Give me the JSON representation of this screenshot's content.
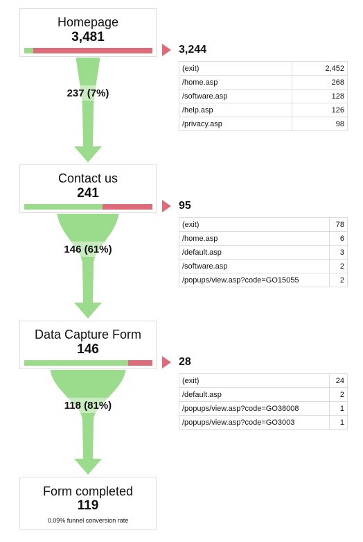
{
  "colors": {
    "continue": "#9bdc8c",
    "exit": "#dd6b7a"
  },
  "steps": [
    {
      "title": "Homepage",
      "count": "3,481",
      "continue_fraction": 0.07,
      "flow_label": "237 (7%)",
      "exit_count": "3,244",
      "exits": [
        {
          "page": "(exit)",
          "count": "2,452"
        },
        {
          "page": "/home.asp",
          "count": "268"
        },
        {
          "page": "/software.asp",
          "count": "128"
        },
        {
          "page": "/help.asp",
          "count": "126"
        },
        {
          "page": "/privacy.asp",
          "count": "98"
        }
      ]
    },
    {
      "title": "Contact us",
      "count": "241",
      "continue_fraction": 0.61,
      "flow_label": "146 (61%)",
      "exit_count": "95",
      "exits": [
        {
          "page": "(exit)",
          "count": "78"
        },
        {
          "page": "/home.asp",
          "count": "6"
        },
        {
          "page": "/default.asp",
          "count": "3"
        },
        {
          "page": "/software.asp",
          "count": "2"
        },
        {
          "page": "/popups/view.asp?code=GO15055",
          "count": "2"
        }
      ]
    },
    {
      "title": "Data Capture Form",
      "count": "146",
      "continue_fraction": 0.81,
      "flow_label": "118 (81%)",
      "exit_count": "28",
      "exits": [
        {
          "page": "(exit)",
          "count": "24"
        },
        {
          "page": "/default.asp",
          "count": "2"
        },
        {
          "page": "/popups/view.asp?code=GO38008",
          "count": "1"
        },
        {
          "page": "/popups/view.asp?code=GO3003",
          "count": "1"
        }
      ]
    }
  ],
  "final": {
    "title": "Form completed",
    "count": "119",
    "conversion_rate": "0.09% funnel conversion rate"
  }
}
